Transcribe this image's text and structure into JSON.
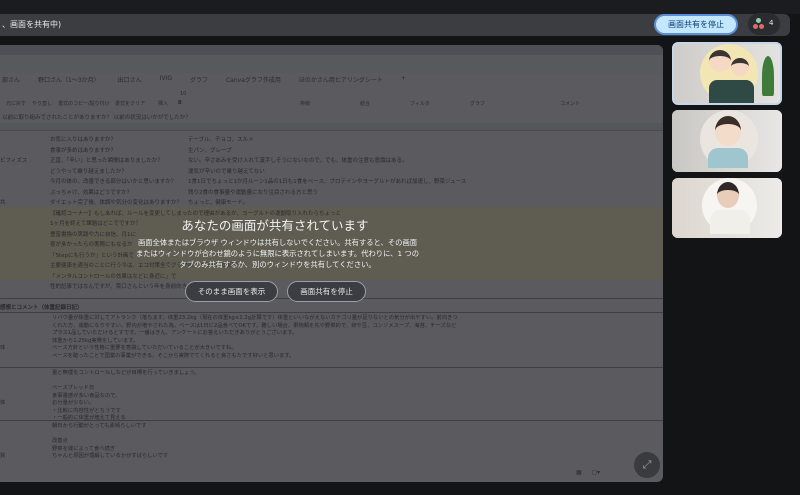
{
  "banner": {
    "text": "、画面を共有中)",
    "stop_button": "画面共有を停止",
    "participant_count": "4"
  },
  "sheet": {
    "tabs": [
      "部さん",
      "野口さん（1〜3か月）",
      "出口さん",
      "IVIG",
      "グラフ",
      "Canvaグラフ作成用",
      "ほのかさん用ヒアリングシート",
      "+"
    ],
    "toolbar": {
      "undo": "元に戻す",
      "redo": "やり直し",
      "paste": "書式のコピー/貼り付け",
      "clear": "書式をクリア",
      "insert": "挿入",
      "font_size": "10",
      "borders": "枠線",
      "merge": "結合",
      "filter": "フィルタ",
      "chart": "グラフ",
      "comment": "コメント"
    },
    "formula": "以前に取り組みでされたことがありますか？ 以前の状況はいかがでしたか？",
    "rows": [
      {
        "a": "",
        "b": "",
        "c": "お気に入りはありますか？",
        "d": "テーブル、チョコ、スルメ"
      },
      {
        "a": "",
        "b": "",
        "c": "食事が多めはありますか？",
        "d": "生パン、グレープ"
      },
      {
        "a": "ビフィズス",
        "b": "",
        "c": "正直、「辛い」と思った瞬間はありましたか？",
        "d": "ない。辛さあみを受け入れて漢字しそうにないなので。でも、体重の注意も意識はある。"
      },
      {
        "a": "",
        "b": "",
        "c": "どうやって乗り越えましたか？",
        "d": "運気が辛いので乗り越えてない"
      },
      {
        "a": "",
        "b": "",
        "c": "今月の体の、改善できる部分はいかと思いますか？",
        "d": "1食1日でちょっと1か月ルーン1品の1日も1食をベース、プロテインやヨーグルトがあれば加速し、野菜ジュース"
      },
      {
        "a": "",
        "b": "",
        "c": "ぶっちゃけ、効果はどうですか？",
        "d": "残り2食の食事量や運動量になり注目される方と思う"
      },
      {
        "a": "共",
        "b": "",
        "c": "ダイエット完了後、体調や気分の変化はありますか？",
        "d": "ちょっと、健康モード。"
      },
      {
        "a": "",
        "b": "",
        "c": "【確認コーナー】もしあれば、ルールを変更してしまったので理由があるか、ヨーグルトの運動取り入れたらちょっと",
        "d": ""
      },
      {
        "a": "",
        "b": "",
        "c": "1ヶ月を終えて課題はどこでですか？",
        "d": ""
      },
      {
        "a": "",
        "b": "",
        "c": "豊富書換の実践や力に自信、月1に",
        "d": ""
      },
      {
        "a": "",
        "b": "",
        "c": "夜が多かったらの実際にもなるか",
        "d": ""
      },
      {
        "a": "",
        "b": "",
        "c": "「Stepにも行うか」という計画で",
        "d": ""
      },
      {
        "a": "",
        "b": "",
        "c": "主要健康を適当のことに行う今は、エコ対策全てグラフ率ハイライトの影響で",
        "d": ""
      },
      {
        "a": "",
        "b": "",
        "c": "「メンタルコントロールの効果はなどに身近に」で",
        "d": ""
      },
      {
        "a": "",
        "b": "",
        "c": "性的記事ではなんですが、菜口さんという年を身前向きに",
        "d": ""
      }
    ],
    "section_header": "感想とコメント（体重記録日記）",
    "blocks": [
      {
        "a": "体",
        "lines": [
          "リバウ量が体重に対してアトランク（落ちます。体重23.2kg（現在の体重kg×1.2g計算です）体重といいながえないカテゴリ量が足りないとの気分が出やすい。前向きつ",
          "くれた方、運動になりやすい。野内が増やされた為。ベースは1日に2品食べてOKです。難しい場合、果物類を先や野菜的で、卵や豆、コンソメスープ、海苔、チーズなど",
          "プラス1品していただけるとすです。一番はきん、アンケートにお答えいただきありがとうございます。",
          "体重から1.25kg実費をしています。",
          "ベース方針という性格に重要を意識していただいていることが大きいですね。",
          "ペースを踏ったことで国業の事業ができる。そこから実際でてくれると良さもたです好いと思います。"
        ]
      },
      {
        "a": "体",
        "lines": [
          "量と無理をコントロールしなどが目標を行っていきましょう。",
          "",
          "ベースブレッド日",
          "食事量感が多い食品なので、",
          "お分量が少ない。",
          "・比較に内容性がとちうです",
          "・一般的に体重が増えて見える"
        ]
      },
      {
        "a": "質",
        "lines": [
          "朝日から行動がとっても素晴らしいです",
          "",
          "改善点",
          "野菜を運によって食べ続ぎ",
          "ちゃんと原因が理解しているかがすばらしいです"
        ]
      }
    ]
  },
  "overlay": {
    "title": "あなたの画面が共有されています",
    "message": "画面全体またはブラウザ ウィンドウは共有しないでください。共有すると、その画面またはウィンドウが合わせ鏡のように無限に表示されてしまいます。代わりに、1 つのタブのみ共有するか、別のウィンドウを共有してください。",
    "show_anyway": "そのまま画面を表示",
    "stop_sharing": "画面共有を停止"
  },
  "colors": {
    "stop_bg": "#c2e7ff",
    "stop_border": "#5b8fd6",
    "share_bg": "#5a5a5f",
    "page_bg": "#131416"
  }
}
